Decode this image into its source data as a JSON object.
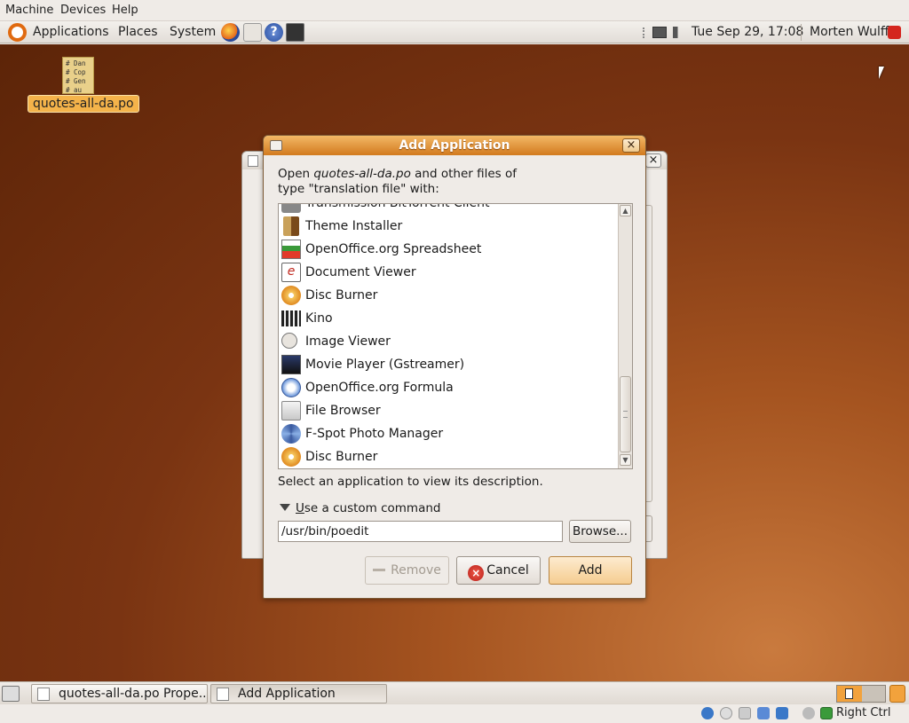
{
  "vbox_menu": {
    "machine": "Machine",
    "devices": "Devices",
    "help": "Help"
  },
  "top_panel": {
    "applications": "Applications",
    "places": "Places",
    "system": "System",
    "clock": "Tue Sep 29, 17:08",
    "user": "Morten Wulff"
  },
  "desktop": {
    "file_label": "quotes-all-da.po",
    "file_preview": [
      "# Dan",
      "# Cop",
      "# Gen",
      "#  au"
    ]
  },
  "dialog": {
    "title": "Add Application",
    "intro_prefix": "Open ",
    "intro_file": "quotes-all-da.po",
    "intro_suffix": " and other files of",
    "intro_line2": "type \"translation file\" with:",
    "apps": [
      {
        "name": "Transmission BitTorrent Client",
        "icon": "transmission-icon"
      },
      {
        "name": "Theme Installer",
        "icon": "theme-installer-icon"
      },
      {
        "name": "OpenOffice.org Spreadsheet",
        "icon": "spreadsheet-icon"
      },
      {
        "name": "Document Viewer",
        "icon": "document-viewer-icon"
      },
      {
        "name": "Disc Burner",
        "icon": "disc-burner-icon"
      },
      {
        "name": "Kino",
        "icon": "kino-icon"
      },
      {
        "name": "Image Viewer",
        "icon": "image-viewer-icon"
      },
      {
        "name": "Movie Player (Gstreamer)",
        "icon": "movie-player-icon"
      },
      {
        "name": "OpenOffice.org Formula",
        "icon": "formula-icon"
      },
      {
        "name": "File Browser",
        "icon": "file-browser-icon"
      },
      {
        "name": "F-Spot Photo Manager",
        "icon": "f-spot-icon"
      },
      {
        "name": "Disc Burner",
        "icon": "disc-burner-icon"
      }
    ],
    "description": "Select an application to view its description.",
    "custom_prefix": "U",
    "custom_rest": "se a custom command",
    "command_value": "/usr/bin/poedit",
    "browse_label": "Browse...",
    "remove_label": "Remove",
    "cancel_label": "Cancel",
    "add_label": "Add"
  },
  "taskbar": {
    "task_properties": "quotes-all-da.po Prope...",
    "task_add": "Add Application"
  },
  "vbox_status": {
    "host_key": "Right Ctrl"
  },
  "colors": {
    "title_bar": "#d27a1e",
    "selection": "#f4b34a",
    "desktop": "#7a3412",
    "cancel_red": "#c0281e"
  }
}
